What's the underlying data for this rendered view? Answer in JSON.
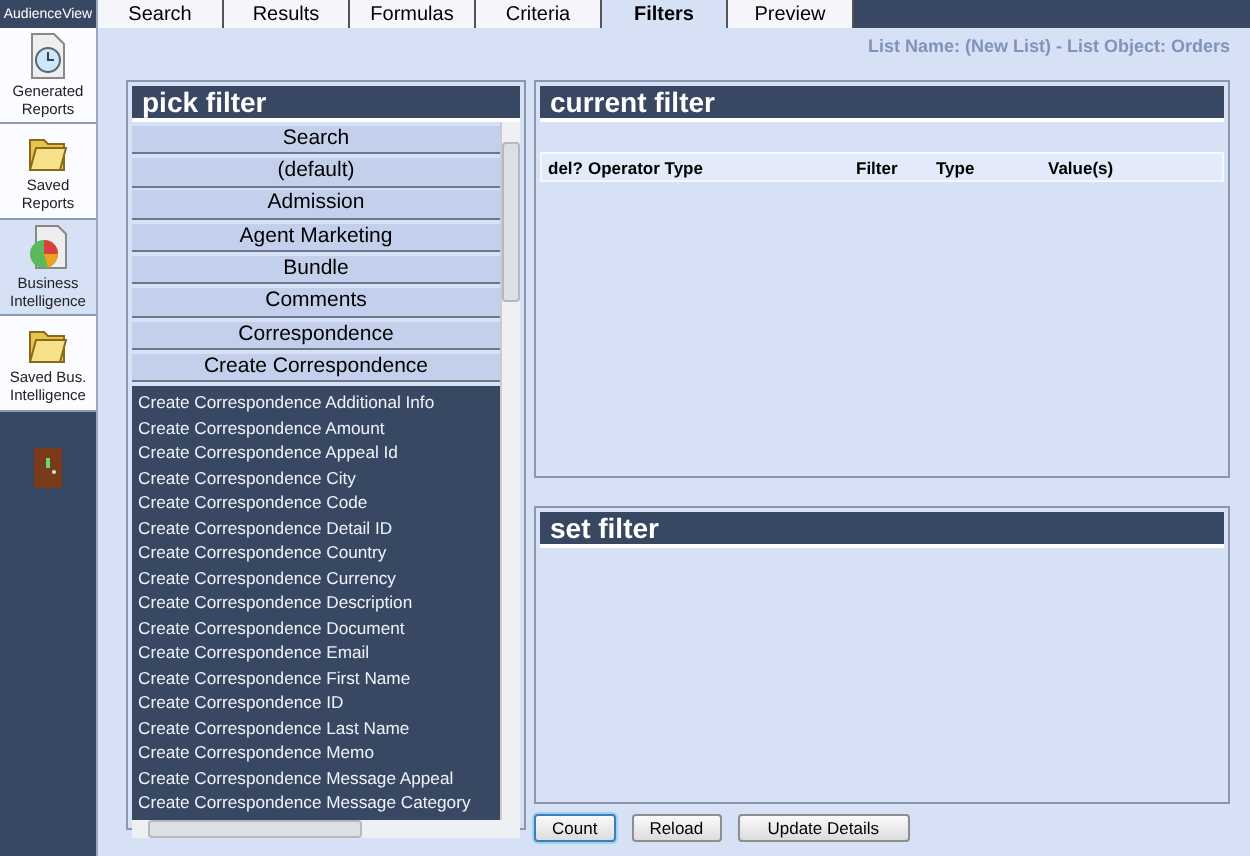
{
  "app": {
    "title": "AudienceView"
  },
  "sidebar": {
    "items": [
      {
        "label": "Generated Reports",
        "kind": "clock",
        "selected": false
      },
      {
        "label": "Saved Reports",
        "kind": "folder",
        "selected": false
      },
      {
        "label": "Business Intelligence",
        "kind": "chart",
        "selected": true
      },
      {
        "label": "Saved Bus. Intelligence",
        "kind": "folder",
        "selected": false
      }
    ]
  },
  "tabs": [
    {
      "label": "Search",
      "selected": false
    },
    {
      "label": "Results",
      "selected": false
    },
    {
      "label": "Formulas",
      "selected": false
    },
    {
      "label": "Criteria",
      "selected": false
    },
    {
      "label": "Filters",
      "selected": true
    },
    {
      "label": "Preview",
      "selected": false
    }
  ],
  "list_info": "List Name: (New List) - List Object: Orders",
  "pick_filter": {
    "title": "pick filter",
    "categories": [
      {
        "label": "Search"
      },
      {
        "label": "(default)"
      },
      {
        "label": "Admission"
      },
      {
        "label": "Agent Marketing"
      },
      {
        "label": "Bundle"
      },
      {
        "label": "Comments"
      },
      {
        "label": "Correspondence"
      },
      {
        "label": "Create Correspondence",
        "children": [
          "Create Correspondence Additional Info",
          "Create Correspondence Amount",
          "Create Correspondence Appeal Id",
          "Create Correspondence City",
          "Create Correspondence Code",
          "Create Correspondence Detail ID",
          "Create Correspondence Country",
          "Create Correspondence Currency",
          "Create Correspondence Description",
          "Create Correspondence Document",
          "Create Correspondence Email",
          "Create Correspondence First Name",
          "Create Correspondence ID",
          "Create Correspondence Last Name",
          "Create Correspondence Memo",
          "Create Correspondence Message Appeal",
          "Create Correspondence Message Category"
        ]
      }
    ]
  },
  "current_filter": {
    "title": "current filter",
    "columns": [
      "del?",
      "Operator Type",
      "Filter",
      "Type",
      "Value(s)"
    ]
  },
  "set_filter": {
    "title": "set filter"
  },
  "buttons": [
    {
      "label": "Count",
      "focused": true
    },
    {
      "label": "Reload",
      "focused": false
    },
    {
      "label": "Update Details",
      "focused": false
    }
  ]
}
